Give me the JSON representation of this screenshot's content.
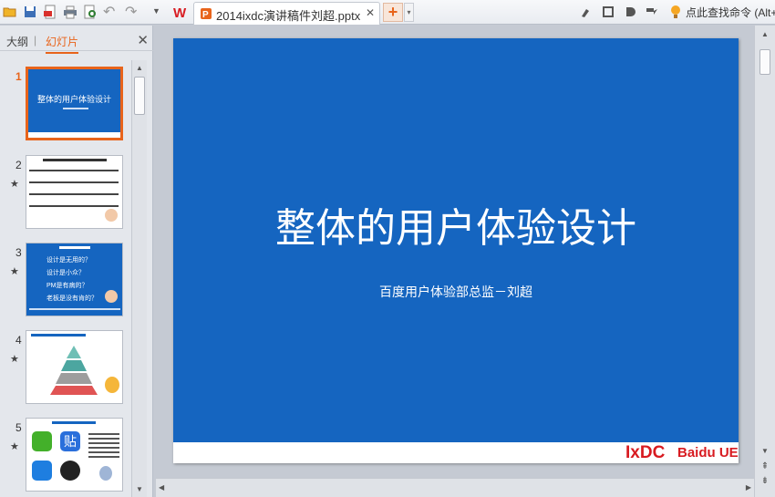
{
  "toolbar": {
    "icons": [
      "open-icon",
      "save-icon",
      "pdf-export-icon",
      "print-icon",
      "print-preview-icon",
      "undo-icon",
      "redo-icon",
      "dropdown-icon"
    ],
    "undo_glyph": "↶",
    "redo_glyph": "↷",
    "dropdown_glyph": "▼",
    "doc_tab_title": "2014ixdc演讲稿件刘超.pptx",
    "doc_tab_close": "✕",
    "new_tab": "+",
    "new_tab_dropdown": "▾",
    "find_command": "点此查找命令 (Alt+",
    "right_icons": [
      "brush-icon",
      "save-icon",
      "disk-icon",
      "share-icon",
      "bulb-icon"
    ]
  },
  "panel": {
    "tab_outline": "大纲",
    "separator": "|",
    "tab_slides": "幻灯片",
    "close": "✕",
    "slides": [
      {
        "num": "1",
        "star": "",
        "title": "整体的用户体验设计"
      },
      {
        "num": "2",
        "star": "★",
        "title": ""
      },
      {
        "num": "3",
        "star": "★",
        "title": "",
        "lines": [
          "设计是无用的？",
          "设计是小众？",
          "PM是有病的？",
          "老板是没有肯的？"
        ]
      },
      {
        "num": "4",
        "star": "★",
        "title": ""
      },
      {
        "num": "5",
        "star": "★",
        "title": "",
        "icon_text": "贴"
      }
    ]
  },
  "slide": {
    "title": "整体的用户体验设计",
    "subtitle": "百度用户体验部总监－刘超",
    "logo_ixdc": "IxDC",
    "logo_baidu": "Baidu UE"
  },
  "scroll": {
    "up": "▲",
    "down": "▼",
    "left": "◀",
    "right": "▶",
    "double_up": "⇞",
    "double_down": "⇟"
  },
  "colors": {
    "accent": "#e8641b",
    "slide_bg": "#1565c0",
    "logo_red": "#d81b21"
  }
}
